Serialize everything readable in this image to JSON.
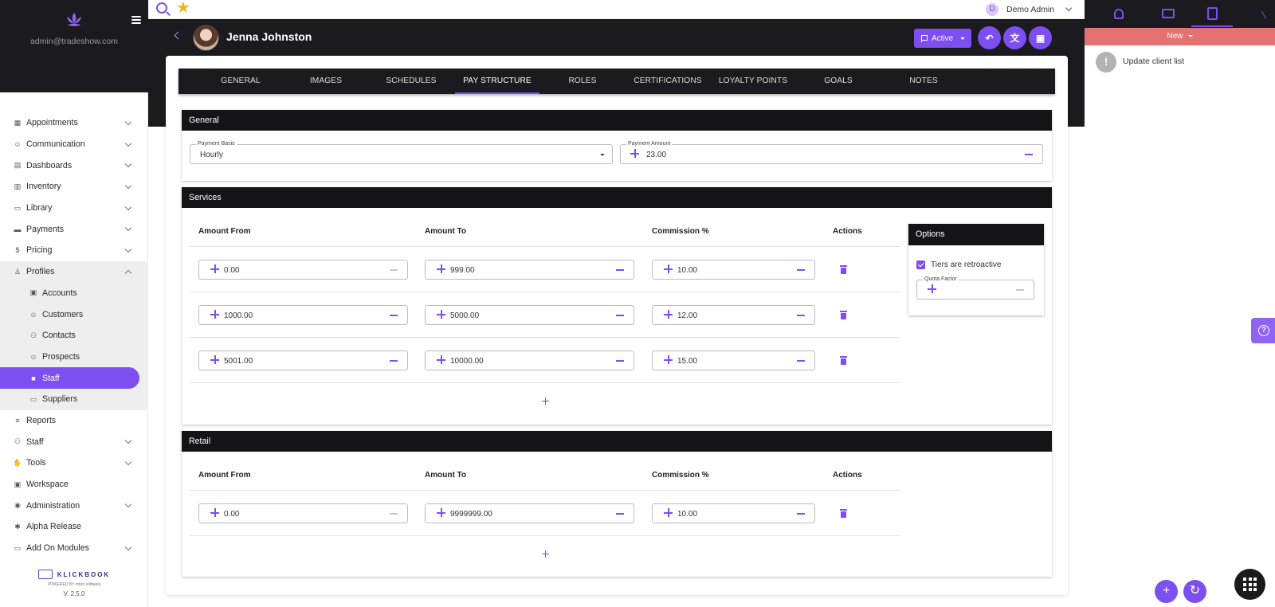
{
  "app": {
    "sidebar_email": "admin@tradeshow.com",
    "version": "V. 2.5.0",
    "brand_name": "KLICKBOOK",
    "brand_powered": "POWERED BY mbro software"
  },
  "colors": {
    "accent": "#7d4ef2",
    "dark": "#1b1b1f",
    "task_banner": "#e27372"
  },
  "nav": [
    {
      "label": "Appointments",
      "icon": "calendar-icon"
    },
    {
      "label": "Communication",
      "icon": "users-chat-icon"
    },
    {
      "label": "Dashboards",
      "icon": "dashboard-icon"
    },
    {
      "label": "Inventory",
      "icon": "inventory-icon"
    },
    {
      "label": "Library",
      "icon": "library-icon"
    },
    {
      "label": "Payments",
      "icon": "card-icon"
    },
    {
      "label": "Pricing",
      "icon": "dollar-icon"
    },
    {
      "label": "Profiles",
      "icon": "person-icon"
    }
  ],
  "nav_sub": [
    {
      "label": "Accounts"
    },
    {
      "label": "Customers"
    },
    {
      "label": "Contacts"
    },
    {
      "label": "Prospects"
    },
    {
      "label": "Staff"
    },
    {
      "label": "Suppliers"
    }
  ],
  "nav_after": [
    {
      "label": "Reports"
    },
    {
      "label": "Staff"
    },
    {
      "label": "Tools"
    },
    {
      "label": "Workspace"
    },
    {
      "label": "Administration"
    },
    {
      "label": "Alpha Release"
    },
    {
      "label": "Add On Modules"
    }
  ],
  "topbar": {
    "user_initial": "D",
    "user_name": "Demo Admin"
  },
  "header": {
    "person_name": "Jenna Johnston",
    "status": "Active"
  },
  "tabs": [
    "GENERAL",
    "IMAGES",
    "SCHEDULES",
    "PAY STRUCTURE",
    "ROLES",
    "CERTIFICATIONS",
    "LOYALTY POINTS",
    "GOALS",
    "NOTES"
  ],
  "general": {
    "title": "General",
    "payment_basis_label": "Payment Basis",
    "payment_basis_value": "Hourly",
    "payment_amount_label": "Payment Amount",
    "payment_amount_value": "23.00"
  },
  "services": {
    "title": "Services",
    "col_from": "Amount From",
    "col_to": "Amount To",
    "col_commission": "Commission %",
    "col_actions": "Actions",
    "rows": [
      {
        "from": "0.00",
        "to": "999.00",
        "commission": "10.00"
      },
      {
        "from": "1000.00",
        "to": "5000.00",
        "commission": "12.00"
      },
      {
        "from": "5001.00",
        "to": "10000.00",
        "commission": "15.00"
      }
    ]
  },
  "options": {
    "title": "Options",
    "retroactive_label": "Tiers are retroactive",
    "retroactive_checked": true,
    "quota_label": "Quota Factor"
  },
  "retail": {
    "title": "Retail",
    "col_from": "Amount From",
    "col_to": "Amount To",
    "col_commission": "Commission %",
    "col_actions": "Actions",
    "rows": [
      {
        "from": "0.00",
        "to": "9999999.00",
        "commission": "10.00"
      }
    ]
  },
  "right_panel": {
    "filter": "New",
    "tasks": [
      {
        "text": "Update client list"
      }
    ]
  }
}
